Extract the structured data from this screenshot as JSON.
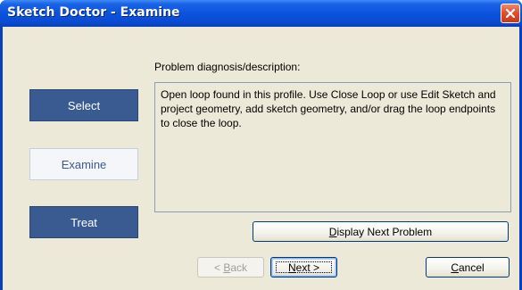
{
  "window": {
    "title": "Sketch Doctor - Examine"
  },
  "nav": {
    "items": [
      {
        "label": "Select",
        "state": "normal"
      },
      {
        "label": "Examine",
        "state": "active"
      },
      {
        "label": "Treat",
        "state": "normal"
      }
    ]
  },
  "description": {
    "label": "Problem diagnosis/description:",
    "text": "Open loop found in this profile.  Use Close Loop or use Edit Sketch and project geometry, add sketch geometry, and/or drag the loop endpoints to close the loop."
  },
  "buttons": {
    "display_next": {
      "mnemonic": "D",
      "rest": "isplay Next Problem"
    },
    "back": {
      "prefix": "< ",
      "mnemonic": "B",
      "rest": "ack"
    },
    "next": {
      "mnemonic": "N",
      "rest": "ext >"
    },
    "cancel": {
      "mnemonic": "C",
      "rest": "ancel"
    }
  },
  "colors": {
    "titlebar": "#0a54de",
    "nav_dark": "#3a5a92",
    "nav_light": "#f4f6f9",
    "dialog_bg": "#ece9d8",
    "close_button": "#e0502f"
  }
}
